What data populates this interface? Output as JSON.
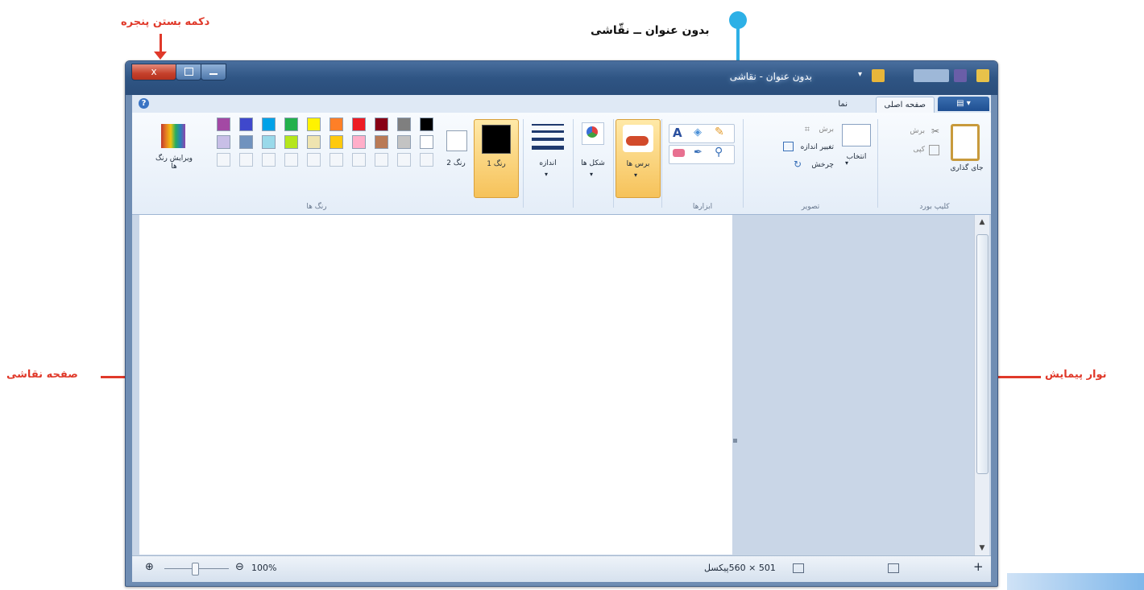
{
  "annotations": {
    "close_button": "دکمه بستن پنجره",
    "title_bar": "بدون عنوان ــ نقّاشی",
    "canvas": "صفحه نقاشی",
    "scrollbar": "نوار پیمایش"
  },
  "window": {
    "title": "بدون عنوان - نقاشی",
    "close_label": "x"
  },
  "ribbon": {
    "tabs": [
      "صفحه اصلی",
      "نما"
    ],
    "groups": {
      "clipboard": {
        "label": "کلیپ بورد",
        "paste": "جای گذاری",
        "cut": "برش",
        "copy": "کپی"
      },
      "image": {
        "label": "تصویر",
        "select": "انتخاب",
        "crop": "برش",
        "resize": "تغییر اندازه",
        "rotate": "چرخش"
      },
      "tools": {
        "label": "ابزارها"
      },
      "brushes": {
        "label": "برس ها"
      },
      "shapes": {
        "label": "شکل ها"
      },
      "size": {
        "label": "اندازه"
      },
      "color1": {
        "label": "رنگ 1"
      },
      "color2": {
        "label": "رنگ 2"
      },
      "colors": {
        "label": "رنگ ها",
        "edit": "ویرایش رنگ ها"
      }
    }
  },
  "palette": {
    "row1": [
      "#000000",
      "#7f7f7f",
      "#880015",
      "#ed1c24",
      "#ff7f27",
      "#fff200",
      "#22b14c",
      "#00a2e8",
      "#3f48cc",
      "#a349a4"
    ],
    "row2": [
      "#ffffff",
      "#c3c3c3",
      "#b97a57",
      "#ffaec9",
      "#ffc90e",
      "#efe4b0",
      "#b5e61d",
      "#99d9ea",
      "#7092be",
      "#c8bfe7"
    ],
    "color1": "#000000",
    "color2": "#ffffff"
  },
  "status": {
    "zoom": "100%",
    "dimensions": "501 × 560پیکسل"
  }
}
